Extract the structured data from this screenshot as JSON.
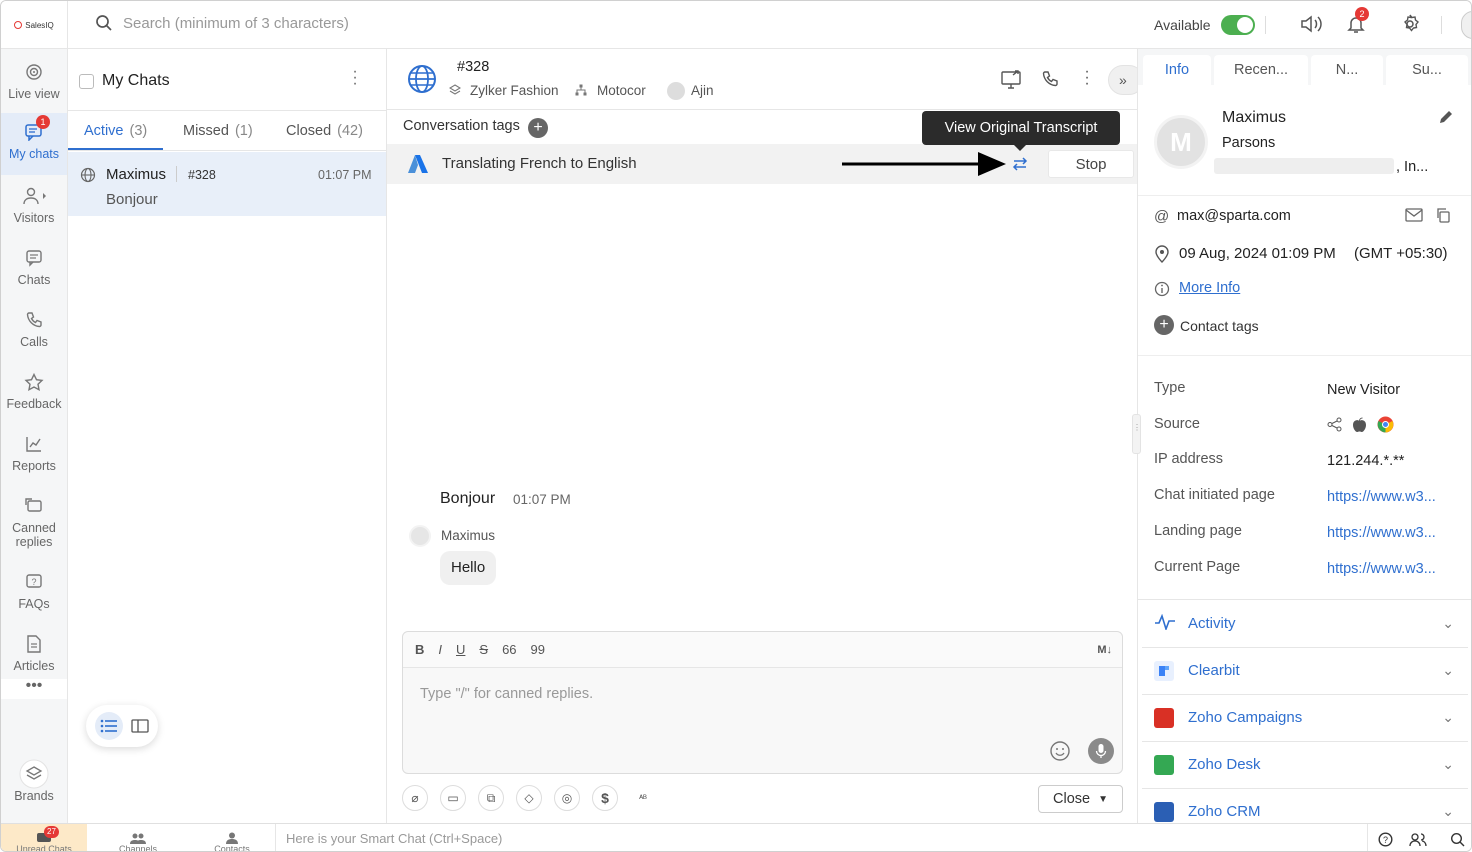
{
  "app": {
    "logo_text": "SalesIQ"
  },
  "topbar": {
    "search_placeholder": "Search (minimum of 3 characters)",
    "status_label": "Available",
    "notifications_count": "2"
  },
  "nav": {
    "items": [
      {
        "label": "Live view"
      },
      {
        "label": "My chats",
        "badge": "1"
      },
      {
        "label": "Visitors"
      },
      {
        "label": "Chats"
      },
      {
        "label": "Calls"
      },
      {
        "label": "Feedback"
      },
      {
        "label": "Reports"
      },
      {
        "label": "Canned replies"
      },
      {
        "label": "FAQs"
      },
      {
        "label": "Articles"
      },
      {
        "label": "Brands"
      }
    ]
  },
  "chatlist": {
    "title": "My Chats",
    "tabs": [
      {
        "label": "Active",
        "count": "(3)"
      },
      {
        "label": "Missed",
        "count": "(1)"
      },
      {
        "label": "Closed",
        "count": "(42)"
      }
    ],
    "chats": [
      {
        "name": "Maximus",
        "id": "#328",
        "time": "01:07 PM",
        "preview": "Bonjour"
      }
    ]
  },
  "conversation": {
    "id": "#328",
    "brand": "Zylker Fashion",
    "department": "Motocor",
    "operator": "Ajin",
    "tags_label": "Conversation tags",
    "translate_text": "Translating French to English",
    "tooltip": "View Original Transcript",
    "stop_label": "Stop",
    "messages": [
      {
        "text": "Bonjour",
        "time": "01:07 PM"
      },
      {
        "sender": "Maximus",
        "text": "Hello"
      }
    ],
    "composer_placeholder": "Type \"/\" for canned replies.",
    "close_label": "Close",
    "format_buttons": [
      "B",
      "I",
      "U",
      "S",
      "66",
      "99"
    ],
    "md_label": "M↓"
  },
  "info": {
    "tabs": [
      "Info",
      "Recen...",
      "N...",
      "Su..."
    ],
    "first_name": "Maximus",
    "last_name": "Parsons",
    "company": ", In...",
    "email": "max@sparta.com",
    "datetime": "09 Aug, 2024 01:09 PM",
    "timezone": "(GMT +05:30)",
    "more_info": "More Info",
    "contact_tags": "Contact tags",
    "details": [
      {
        "key": "Type",
        "value": "New Visitor"
      },
      {
        "key": "Source",
        "value": ""
      },
      {
        "key": "IP address",
        "value": "121.244.*.**"
      },
      {
        "key": "Chat initiated page",
        "value": "https://www.w3..."
      },
      {
        "key": "Landing page",
        "value": "https://www.w3..."
      },
      {
        "key": "Current Page",
        "value": "https://www.w3..."
      }
    ],
    "integrations": [
      {
        "label": "Activity",
        "color": "#2f6fcf"
      },
      {
        "label": "Clearbit",
        "color": "#3b82f6"
      },
      {
        "label": "Zoho Campaigns",
        "color": "#d93025"
      },
      {
        "label": "Zoho Desk",
        "color": "#34a853"
      },
      {
        "label": "Zoho CRM",
        "color": "#2b5fb4"
      }
    ]
  },
  "statusbar": {
    "unread_label": "Unread Chats",
    "unread_count": "27",
    "channels_label": "Channels",
    "contacts_label": "Contacts",
    "smart_chat_placeholder": "Here is your Smart Chat (Ctrl+Space)"
  }
}
